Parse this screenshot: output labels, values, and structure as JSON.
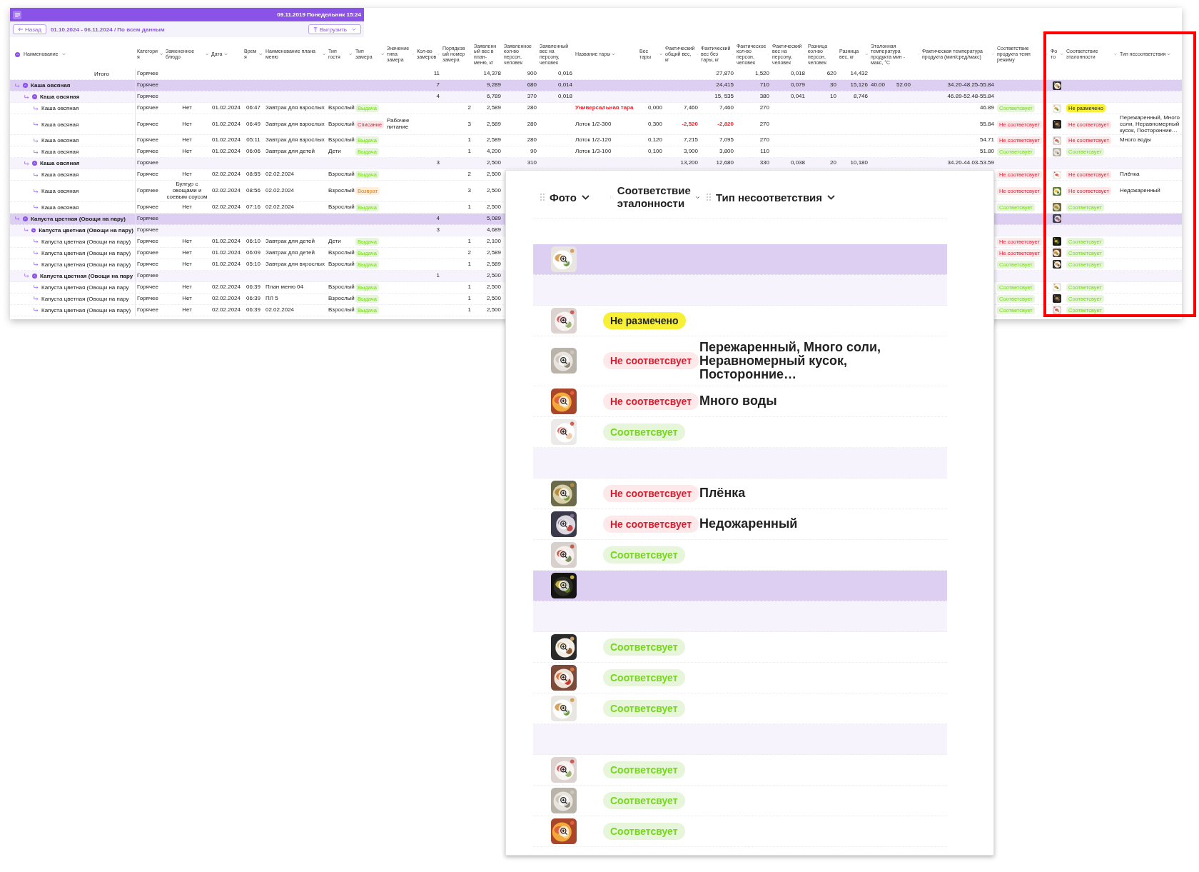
{
  "window": {
    "date_time": "09.11.2019 Понедельник 15:24"
  },
  "toolbar": {
    "back_button": "Назад",
    "period": "01.10.2024 - 06.11.2024 / По всем данным",
    "export_button": "Выгрузить"
  },
  "table": {
    "columns": [
      {
        "label": "Наименование"
      },
      {
        "label": "Категория"
      },
      {
        "label": "Замененное блюдо"
      },
      {
        "label": "Дата"
      },
      {
        "label": "Время"
      },
      {
        "label": "Наименование плана меню"
      },
      {
        "label": "Тип гостя"
      },
      {
        "label": "Тип замера"
      },
      {
        "label": "Значение типа замера"
      },
      {
        "label": "Кол-во замеров"
      },
      {
        "label": "Порядковый номер замера"
      },
      {
        "label": "Заявленный вес в план-меню, кг"
      },
      {
        "label": "Заявленное кол-во персон, человек"
      },
      {
        "label": "Заявленный вес на персону, человек"
      },
      {
        "label": "Название тары"
      },
      {
        "label": "Вес тары"
      },
      {
        "label": "Фактический общий вес, кг"
      },
      {
        "label": "Фактический вес без тары, кг"
      },
      {
        "label": "Фактическое кол-во персон, человек"
      },
      {
        "label": "Фактический вес на персону, человек"
      },
      {
        "label": "Разница кол-во персон, человек"
      },
      {
        "label": "Разница вес, кг"
      },
      {
        "label": "Эталонная температура продукта мин - макс, °С"
      },
      {
        "label": "Фактическая температура продукта (мин/сред/макс)"
      },
      {
        "label": "Соответствие продукта темп режиму"
      },
      {
        "label": "Фото"
      },
      {
        "label": "Соответствие эталонности"
      },
      {
        "label": "Тип несоответствия"
      }
    ],
    "rows": [
      {
        "kind": "total",
        "name": "Итого",
        "cells": {
          "category": "Горячее",
          "count": "11",
          "plan_weight": "14,378",
          "plan_persons": "900",
          "plan_per_person": "0,016",
          "fact_net": "27,870",
          "fact_persons": "1,520",
          "fact_per_person": "0,018",
          "diff_persons": "620",
          "diff_weight": "14,432"
        }
      },
      {
        "kind": "row",
        "name": "Каша овсяная",
        "expanded": true,
        "cells": {
          "category": "Горячее",
          "count": "7",
          "plan_weight": "9,289",
          "plan_persons": "680",
          "plan_per_person": "0,014",
          "fact_net": "24,415",
          "fact_persons": "710",
          "fact_per_person": "0,079",
          "diff_persons": "30",
          "diff_weight": "15,126",
          "ref_min": "40.00",
          "ref_max": "52.00",
          "fact_temp": "34.20-48.25-55.84",
          "photo": {
            "kind": "picture"
          }
        },
        "children": [
          {
            "kind": "row",
            "name": "Каша овсяная",
            "expanded": true,
            "cells": {
              "category": "Горячее",
              "count": "4",
              "plan_weight": "6,789",
              "plan_persons": "370",
              "plan_per_person": "0,018",
              "fact_net": "15, 535",
              "fact_persons": "380",
              "fact_per_person": "0,041",
              "diff_persons": "10",
              "diff_weight": "8,746",
              "fact_temp": "46.89-52.48-55.84"
            },
            "children": [
              {
                "kind": "row",
                "name": "Каша овсяная",
                "cells": {
                  "category": "Горячее",
                  "replaced": "Нет",
                  "date": "01.02.2024",
                  "time": "06:47",
                  "plan": "Завтрак для взрослых",
                  "guest": "Взрослый",
                  "measure_type": {
                    "text": "Выдача",
                    "color": "#e7f5da"
                  },
                  "order": "2",
                  "plan_weight": "2,589",
                  "plan_persons": "280",
                  "tare": {
                    "text": "Универсальная тара",
                    "alert": true
                  },
                  "tare_weight": "0,000",
                  "fact_total": "7,460",
                  "fact_net": "7,460",
                  "fact_persons": "270",
                  "fact_temp": "46.89",
                  "temp_match": {
                    "text": "Соответсвует",
                    "color": "#e7f5da"
                  },
                  "photo": {
                    "kind": "picture"
                  },
                  "match": {
                    "text": "Не размечено",
                    "color": "#f7f034"
                  }
                }
              },
              {
                "kind": "row",
                "name": "Каша овсяная",
                "cells": {
                  "category": "Горячее",
                  "replaced": "Нет",
                  "date": "01.02.2024",
                  "time": "06:49",
                  "plan": "Завтрак для взрослых",
                  "guest": "Взрослый",
                  "measure_type": {
                    "text": "Списание",
                    "color": "#fde8ea"
                  },
                  "measure_value": "Рабочее питание",
                  "order": "3",
                  "plan_weight": "2,589",
                  "plan_persons": "280",
                  "tare": "Лоток 1/2-300",
                  "tare_weight": "0,300",
                  "fact_total": {
                    "text": "-2,520",
                    "alert": true
                  },
                  "fact_net": {
                    "text": "-2,820",
                    "alert": true
                  },
                  "fact_persons": "270",
                  "fact_temp": "55.84",
                  "temp_match": {
                    "text": "Не соответсвует",
                    "color": "#fde8ea"
                  },
                  "photo": {
                    "kind": "picture"
                  },
                  "match": {
                    "text": "Не соответсвует",
                    "color": "#fde8ea"
                  },
                  "defect": "Пережаренный, Много соли, Неравномерный кусок, Посторонние…"
                }
              },
              {
                "kind": "row",
                "name": "Каша овсяная",
                "cells": {
                  "category": "Горячее",
                  "replaced": "Нет",
                  "date": "01.02.2024",
                  "time": "05:11",
                  "plan": "Завтрак для взрослых",
                  "guest": "Взрослый",
                  "measure_type": {
                    "text": "Выдача",
                    "color": "#e7f5da"
                  },
                  "order": "1",
                  "plan_weight": "2,589",
                  "plan_persons": "280",
                  "tare": "Лоток 1/2-120",
                  "tare_weight": "0,120",
                  "fact_total": "7,215",
                  "fact_net": "7,095",
                  "fact_persons": "270",
                  "fact_temp": "54.71",
                  "temp_match": {
                    "text": "Не соответсвует",
                    "color": "#fde8ea"
                  },
                  "photo": {
                    "kind": "picture"
                  },
                  "match": {
                    "text": "Не соответсвует",
                    "color": "#fde8ea"
                  },
                  "defect": "Много воды"
                }
              },
              {
                "kind": "row",
                "name": "Каша овсяная",
                "cells": {
                  "category": "Горячее",
                  "replaced": "Нет",
                  "date": "01.02.2024",
                  "time": "06:06",
                  "plan": "Завтрак для детей",
                  "guest": "Дети",
                  "measure_type": {
                    "text": "Выдача",
                    "color": "#e7f5da"
                  },
                  "order": "1",
                  "plan_weight": "4,200",
                  "plan_persons": "90",
                  "tare": "Лоток 1/3-100",
                  "tare_weight": "0,100",
                  "fact_total": "3,900",
                  "fact_net": "3,800",
                  "fact_persons": "110",
                  "fact_temp": "51.80",
                  "temp_match": {
                    "text": "Соответсвует",
                    "color": "#e7f5da"
                  },
                  "photo": {
                    "kind": "picture"
                  },
                  "match": {
                    "text": "Соответсвует",
                    "color": "#e7f5da"
                  }
                }
              }
            ]
          },
          {
            "kind": "row",
            "name": "Каша овсяная",
            "expanded": true,
            "cells": {
              "category": "Горячее",
              "count": "3",
              "plan_weight": "2,500",
              "plan_persons": "310",
              "fact_total": "13,200",
              "fact_net": "12,680",
              "fact_persons": "330",
              "fact_per_person": "0,038",
              "diff_persons": "20",
              "diff_weight": "10,180",
              "fact_temp": "34.20-44.03-53.59"
            },
            "children": [
              {
                "kind": "row",
                "name": "Каша овсяная",
                "cells": {
                  "category": "Горячее",
                  "replaced": "Нет",
                  "date": "02.02.2024",
                  "time": "08:55",
                  "plan": "02.02.2024",
                  "guest": "Взрослый",
                  "measure_type": {
                    "text": "Выдача",
                    "color": "#e7f5da"
                  },
                  "order": "2",
                  "plan_weight": "2,500",
                  "temp_match": {
                    "text": "Не соответсвует",
                    "color": "#fde8ea"
                  },
                  "photo": {
                    "kind": "picture"
                  },
                  "match": {
                    "text": "Не соответсвует",
                    "color": "#fde8ea"
                  },
                  "defect": "Плёнка"
                }
              },
              {
                "kind": "row",
                "name": "Каша овсяная",
                "cells": {
                  "category": "Горячее",
                  "replaced": "Булгур с овощами и соевым соусом",
                  "date": "02.02.2024",
                  "time": "08:56",
                  "plan": "02.02.2024",
                  "guest": "Взрослый",
                  "measure_type": {
                    "text": "Возврат",
                    "color": "#fdeede"
                  },
                  "order": "3",
                  "plan_weight": "2,500",
                  "temp_match": {
                    "text": "Не соответсвует",
                    "color": "#fde8ea"
                  },
                  "photo": {
                    "kind": "picture"
                  },
                  "match": {
                    "text": "Не соответсвует",
                    "color": "#fde8ea"
                  },
                  "defect": "Недожаренный"
                }
              },
              {
                "kind": "row",
                "name": "Каша овсяная",
                "cells": {
                  "category": "Горячее",
                  "replaced": "Нет",
                  "date": "02.02.2024",
                  "time": "07:16",
                  "plan": "02.02.2024",
                  "guest": "Взрослый",
                  "measure_type": {
                    "text": "Выдача",
                    "color": "#e7f5da"
                  },
                  "order": "1",
                  "plan_weight": "2,500",
                  "temp_match": {
                    "text": "Соответсвует",
                    "color": "#e7f5da"
                  },
                  "photo": {
                    "kind": "picture"
                  },
                  "match": {
                    "text": "Соответсвует",
                    "color": "#e7f5da"
                  }
                }
              }
            ]
          }
        ]
      },
      {
        "kind": "row",
        "name": "Капуста цветная (Овощи на пару)",
        "expanded": true,
        "cells": {
          "category": "Горячее",
          "count": "4",
          "plan_weight": "5,089",
          "photo": {
            "kind": "picture"
          }
        },
        "children": [
          {
            "kind": "row",
            "name": "Капуста цветная  (Овощи на пару)",
            "expanded": true,
            "cells": {
              "category": "Горячее",
              "count": "3",
              "plan_weight": "4,689"
            },
            "children": [
              {
                "kind": "row",
                "name": "Капуста цветная  (Овощи на пару)",
                "cells": {
                  "category": "Горячее",
                  "replaced": "Нет",
                  "date": "01.02.2024",
                  "time": "06:10",
                  "plan": "Завтрак для детей",
                  "guest": "Дети",
                  "measure_type": {
                    "text": "Выдача",
                    "color": "#e7f5da"
                  },
                  "order": "1",
                  "plan_weight": "2,100",
                  "temp_match": {
                    "text": "Не соответсвует",
                    "color": "#fde8ea"
                  },
                  "photo": {
                    "kind": "picture"
                  },
                  "match": {
                    "text": "Соответсвует",
                    "color": "#e7f5da"
                  }
                }
              },
              {
                "kind": "row",
                "name": "Капуста цветная (Овощи на пару)",
                "cells": {
                  "category": "Горячее",
                  "replaced": "Нет",
                  "date": "01.02.2024",
                  "time": "06:09",
                  "plan": "Завтрак для детей",
                  "guest": "Взрослый",
                  "measure_type": {
                    "text": "Выдача",
                    "color": "#e7f5da"
                  },
                  "order": "2",
                  "plan_weight": "2,589",
                  "temp_match": {
                    "text": "Не соответсвует",
                    "color": "#fde8ea"
                  },
                  "photo": {
                    "kind": "picture"
                  },
                  "match": {
                    "text": "Соответсвует",
                    "color": "#e7f5da"
                  }
                }
              },
              {
                "kind": "row",
                "name": "Капуста цветная (Овощи на пару)",
                "cells": {
                  "category": "Горячее",
                  "replaced": "Нет",
                  "date": "01.02.2024",
                  "time": "05:10",
                  "plan": "Завтрак для вхрослых",
                  "guest": "Взрослый",
                  "measure_type": {
                    "text": "Выдача",
                    "color": "#e7f5da"
                  },
                  "order": "1",
                  "plan_weight": "2,589",
                  "temp_match": {
                    "text": "Соответсвует",
                    "color": "#e7f5da"
                  },
                  "photo": {
                    "kind": "picture"
                  },
                  "match": {
                    "text": "Соответсвует",
                    "color": "#e7f5da"
                  }
                }
              }
            ]
          },
          {
            "kind": "row",
            "name": "Капуста цветная (Овощи на пару",
            "expanded": true,
            "cells": {
              "category": "Горячее",
              "count": "1",
              "plan_weight": "2,500"
            },
            "children": [
              {
                "kind": "row",
                "name": "Капуста цветная (Овощи на пару",
                "cells": {
                  "category": "Горячее",
                  "replaced": "Нет",
                  "date": "02.02.2024",
                  "time": "06:39",
                  "plan": "План меню 04",
                  "guest": "Взрослый",
                  "measure_type": {
                    "text": "Выдача",
                    "color": "#e7f5da"
                  },
                  "order": "1",
                  "plan_weight": "2,500",
                  "temp_match": {
                    "text": "Соответсвует",
                    "color": "#e7f5da"
                  },
                  "photo": {
                    "kind": "picture"
                  },
                  "match": {
                    "text": "Соответсвует",
                    "color": "#e7f5da"
                  }
                }
              },
              {
                "kind": "row",
                "name": "Капуста цветная (Овощи на пару",
                "cells": {
                  "category": "Горячее",
                  "replaced": "Нет",
                  "date": "02.02.2024",
                  "time": "06:39",
                  "plan": "ПЛ 5",
                  "guest": "Взрослый",
                  "measure_type": {
                    "text": "Выдача",
                    "color": "#e7f5da"
                  },
                  "order": "1",
                  "plan_weight": "2,500",
                  "temp_match": {
                    "text": "Соответсвует",
                    "color": "#e7f5da"
                  },
                  "photo": {
                    "kind": "picture"
                  },
                  "match": {
                    "text": "Соответсвует",
                    "color": "#e7f5da"
                  }
                }
              },
              {
                "kind": "row",
                "name": "Капуста цветная (Овощи на пару)",
                "cells": {
                  "category": "Горячее",
                  "replaced": "Нет",
                  "date": "02.02.2024",
                  "time": "06:39",
                  "plan": "02.02.2024",
                  "guest": "Взрослый",
                  "measure_type": {
                    "text": "Выдача",
                    "color": "#e7f5da"
                  },
                  "order": "1",
                  "plan_weight": "2,500",
                  "temp_match": {
                    "text": "Соответсвует",
                    "color": "#e7f5da"
                  },
                  "photo": {
                    "kind": "picture"
                  },
                  "match": {
                    "text": "Соответсвует",
                    "color": "#e7f5da"
                  }
                }
              }
            ]
          }
        ]
      }
    ]
  },
  "zoom_panel": {
    "columns": [
      {
        "label": "Фото"
      },
      {
        "label": "Соответствие эталонности"
      },
      {
        "label": "Тип несоответствия"
      }
    ],
    "rows": [
      {
        "photo": {
          "kind": "picture"
        },
        "children": [
          {
            "children": [
              {
                "photo": {
                  "kind": "picture"
                },
                "match": {
                  "text": "Не размечено",
                  "color": "#f7f034"
                }
              },
              {
                "photo": {
                  "kind": "picture"
                },
                "match": {
                  "text": "Не соответсвует",
                  "color": "#fde8ea"
                },
                "defect": "Пережаренный, Много соли, Неравномерный кусок, Посторонние…"
              },
              {
                "photo": {
                  "kind": "picture"
                },
                "match": {
                  "text": "Не соответсвует",
                  "color": "#fde8ea"
                },
                "defect": "Много воды"
              },
              {
                "photo": {
                  "kind": "picture"
                },
                "match": {
                  "text": "Соответсвует",
                  "color": "#e7f5da"
                }
              }
            ]
          },
          {
            "children": [
              {
                "photo": {
                  "kind": "picture"
                },
                "match": {
                  "text": "Не соответсвует",
                  "color": "#fde8ea"
                },
                "defect": "Плёнка"
              },
              {
                "photo": {
                  "kind": "picture"
                },
                "match": {
                  "text": "Не соответсвует",
                  "color": "#fde8ea"
                },
                "defect": "Недожаренный"
              },
              {
                "photo": {
                  "kind": "picture"
                },
                "match": {
                  "text": "Соответсвует",
                  "color": "#e7f5da"
                }
              }
            ]
          }
        ]
      },
      {
        "photo": {
          "kind": "picture"
        },
        "children": [
          {
            "children": [
              {
                "photo": {
                  "kind": "picture"
                },
                "match": {
                  "text": "Соответсвует",
                  "color": "#e7f5da"
                }
              },
              {
                "photo": {
                  "kind": "picture"
                },
                "match": {
                  "text": "Соответсвует",
                  "color": "#e7f5da"
                }
              },
              {
                "photo": {
                  "kind": "picture"
                },
                "match": {
                  "text": "Соответсвует",
                  "color": "#e7f5da"
                }
              }
            ]
          },
          {
            "children": [
              {
                "photo": {
                  "kind": "picture"
                },
                "match": {
                  "text": "Соответсвует",
                  "color": "#e7f5da"
                }
              },
              {
                "photo": {
                  "kind": "picture"
                },
                "match": {
                  "text": "Соответсвует",
                  "color": "#e7f5da"
                }
              },
              {
                "photo": {
                  "kind": "picture"
                },
                "match": {
                  "text": "Соответсвует",
                  "color": "#e7f5da"
                }
              }
            ]
          }
        ]
      }
    ]
  }
}
